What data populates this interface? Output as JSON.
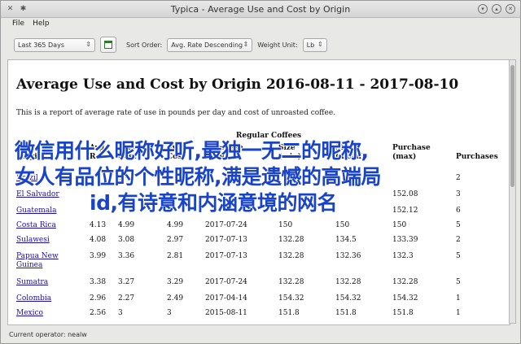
{
  "window": {
    "title": "Typica - Average Use and Cost by Origin"
  },
  "menu": {
    "items": [
      "File",
      "Help"
    ]
  },
  "toolbar": {
    "date_range": "Last 365 Days",
    "sort_label": "Sort Order:",
    "sort_value": "Avg. Rate Descending",
    "weight_label": "Weight Unit:",
    "weight_value": "Lb"
  },
  "report": {
    "title": "Average Use and Cost by Origin 2016-08-11 - 2017-08-10",
    "description": "This is a report of average rate of use in pounds per day and cost of unroasted coffee.",
    "group_header": "Regular Coffees",
    "columns": [
      "Origin",
      "Avg. Rate",
      "Avg. Cost",
      "Avg. Cost",
      "Last Purchase Date",
      "Purchase Size (min)",
      "Purchase Size (mean)",
      "Purchase Size (max)",
      "Purchases"
    ],
    "col_lines": [
      [
        "Origin"
      ],
      [
        "Avg.",
        "Rate"
      ],
      [
        "Avg.",
        "Cost"
      ],
      [
        "Avg.",
        "Cost"
      ],
      [
        "Purchase",
        "Date"
      ],
      [
        "Size",
        "(min)"
      ],
      [
        "Size",
        "(mean)"
      ],
      [
        "Purchase",
        "(max)"
      ],
      [
        "Purchases"
      ]
    ],
    "rows": [
      [
        "Brazil",
        "",
        "4.4",
        "",
        "",
        "",
        "",
        "",
        "2"
      ],
      [
        "El Salvador",
        "",
        "",
        "",
        "",
        "",
        "",
        "152.08",
        "3"
      ],
      [
        "Guatemala",
        "",
        "",
        "",
        "",
        "",
        "",
        "152.12",
        "6"
      ],
      [
        "Costa Rica",
        "4.13",
        "4.99",
        "4.99",
        "2017-07-24",
        "150",
        "150",
        "150",
        "5"
      ],
      [
        "Sulawesi",
        "4.08",
        "3.08",
        "2.97",
        "2017-07-13",
        "132.28",
        "134.5",
        "133.39",
        "2"
      ],
      [
        "Papua New Guinea",
        "3.99",
        "3.36",
        "2.81",
        "2017-07-13",
        "132.28",
        "132.36",
        "132.3",
        "5"
      ],
      [
        "Sumatra",
        "3.38",
        "3.27",
        "3.29",
        "2017-07-24",
        "132.28",
        "132.28",
        "132.28",
        "5"
      ],
      [
        "Colombia",
        "2.96",
        "2.27",
        "2.49",
        "2017-04-14",
        "154.32",
        "154.32",
        "154.32",
        "1"
      ],
      [
        "Mexico",
        "2.56",
        "3",
        "3",
        "2015-08-11",
        "151.8",
        "151.8",
        "151.8",
        "1"
      ]
    ]
  },
  "overlay": {
    "line1": "微信用什么昵称好听,最独一无二的昵称,",
    "line2": "女人有品位的个性昵称,满是遗憾的高端局",
    "line3": "id,有诗意和内涵意境的网名"
  },
  "status": {
    "text": "Current operator: nealw"
  }
}
